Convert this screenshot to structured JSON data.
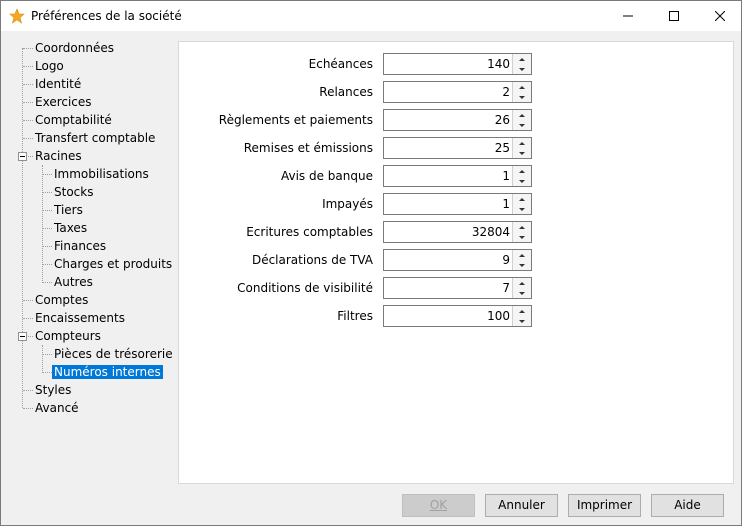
{
  "window": {
    "title": "Préférences de la société",
    "icon": "star-icon",
    "accent": "#0078d7"
  },
  "tree": {
    "items": [
      {
        "label": "Coordonnées",
        "level": 0
      },
      {
        "label": "Logo",
        "level": 0
      },
      {
        "label": "Identité",
        "level": 0
      },
      {
        "label": "Exercices",
        "level": 0
      },
      {
        "label": "Comptabilité",
        "level": 0
      },
      {
        "label": "Transfert comptable",
        "level": 0
      },
      {
        "label": "Racines",
        "level": 0,
        "expanded": true
      },
      {
        "label": "Immobilisations",
        "level": 1
      },
      {
        "label": "Stocks",
        "level": 1
      },
      {
        "label": "Tiers",
        "level": 1
      },
      {
        "label": "Taxes",
        "level": 1
      },
      {
        "label": "Finances",
        "level": 1
      },
      {
        "label": "Charges et produits",
        "level": 1
      },
      {
        "label": "Autres",
        "level": 1
      },
      {
        "label": "Comptes",
        "level": 0
      },
      {
        "label": "Encaissements",
        "level": 0
      },
      {
        "label": "Compteurs",
        "level": 0,
        "expanded": true
      },
      {
        "label": "Pièces de trésorerie",
        "level": 1
      },
      {
        "label": "Numéros internes",
        "level": 1,
        "selected": true
      },
      {
        "label": "Styles",
        "level": 0
      },
      {
        "label": "Avancé",
        "level": 0
      }
    ]
  },
  "fields": [
    {
      "label": "Echéances",
      "value": "140"
    },
    {
      "label": "Relances",
      "value": "2"
    },
    {
      "label": "Règlements et paiements",
      "value": "26"
    },
    {
      "label": "Remises et émissions",
      "value": "25"
    },
    {
      "label": "Avis de banque",
      "value": "1"
    },
    {
      "label": "Impayés",
      "value": "1"
    },
    {
      "label": "Ecritures comptables",
      "value": "32804"
    },
    {
      "label": "Déclarations de TVA",
      "value": "9"
    },
    {
      "label": "Conditions de visibilité",
      "value": "7"
    },
    {
      "label": "Filtres",
      "value": "100"
    }
  ],
  "buttons": {
    "ok": "OK",
    "annuler": "Annuler",
    "imprimer": "Imprimer",
    "aide": "Aide"
  }
}
